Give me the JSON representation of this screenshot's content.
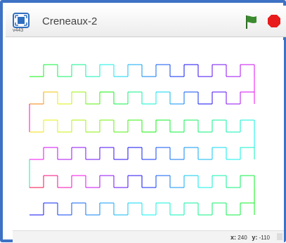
{
  "project": {
    "title": "Creneaux-2",
    "version": "v443"
  },
  "controls": {
    "flag_icon": "green-flag-icon",
    "stop_icon": "red-stop-icon"
  },
  "status": {
    "x_label": "x:",
    "x_value": "240",
    "y_label": "y:",
    "y_value": "-110"
  },
  "colors": {
    "frame": "#3d72c4",
    "flag": "#3a8a2e",
    "stop": "#e81c1c"
  }
}
